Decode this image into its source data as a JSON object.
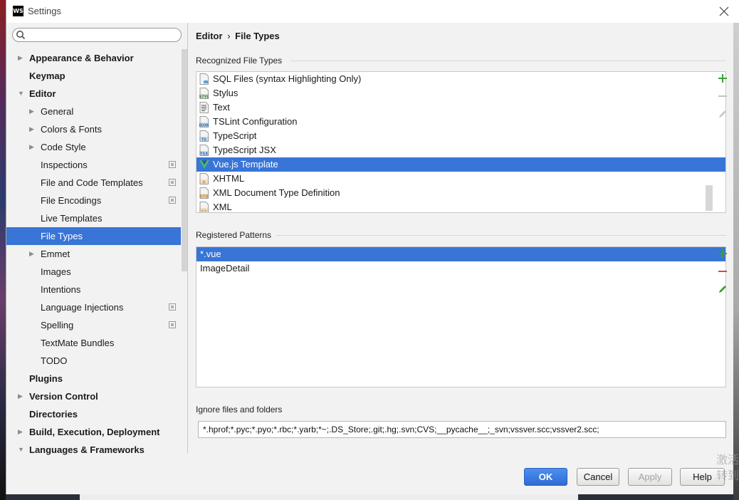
{
  "window": {
    "title": "Settings",
    "logo_text": "WS"
  },
  "search": {
    "value": "",
    "placeholder": ""
  },
  "sidebar": {
    "items": [
      {
        "label": "Appearance & Behavior",
        "level": 0,
        "arrow": "right",
        "bold": true
      },
      {
        "label": "Keymap",
        "level": 0,
        "arrow": "none",
        "bold": true
      },
      {
        "label": "Editor",
        "level": 0,
        "arrow": "down",
        "bold": true
      },
      {
        "label": "General",
        "level": 1,
        "arrow": "right"
      },
      {
        "label": "Colors & Fonts",
        "level": 1,
        "arrow": "right"
      },
      {
        "label": "Code Style",
        "level": 1,
        "arrow": "right"
      },
      {
        "label": "Inspections",
        "level": 1,
        "arrow": "none",
        "project_icon": true
      },
      {
        "label": "File and Code Templates",
        "level": 1,
        "arrow": "none",
        "project_icon": true
      },
      {
        "label": "File Encodings",
        "level": 1,
        "arrow": "none",
        "project_icon": true
      },
      {
        "label": "Live Templates",
        "level": 1,
        "arrow": "none"
      },
      {
        "label": "File Types",
        "level": 1,
        "arrow": "none",
        "selected": true
      },
      {
        "label": "Emmet",
        "level": 1,
        "arrow": "right"
      },
      {
        "label": "Images",
        "level": 1,
        "arrow": "none"
      },
      {
        "label": "Intentions",
        "level": 1,
        "arrow": "none"
      },
      {
        "label": "Language Injections",
        "level": 1,
        "arrow": "none",
        "project_icon": true
      },
      {
        "label": "Spelling",
        "level": 1,
        "arrow": "none",
        "project_icon": true
      },
      {
        "label": "TextMate Bundles",
        "level": 1,
        "arrow": "none"
      },
      {
        "label": "TODO",
        "level": 1,
        "arrow": "none"
      },
      {
        "label": "Plugins",
        "level": 0,
        "arrow": "none",
        "bold": true
      },
      {
        "label": "Version Control",
        "level": 0,
        "arrow": "right",
        "bold": true
      },
      {
        "label": "Directories",
        "level": 0,
        "arrow": "none",
        "bold": true
      },
      {
        "label": "Build, Execution, Deployment",
        "level": 0,
        "arrow": "right",
        "bold": true
      },
      {
        "label": "Languages & Frameworks",
        "level": 0,
        "arrow": "down",
        "bold": true
      }
    ]
  },
  "breadcrumb": {
    "parent": "Editor",
    "separator": "›",
    "current": "File Types"
  },
  "recognized": {
    "title": "Recognized File Types",
    "items": [
      {
        "label": "SQL Files (syntax Highlighting Only)",
        "icon": "sql-file-icon",
        "badge": ""
      },
      {
        "label": "Stylus",
        "icon": "stylus-file-icon",
        "badge": "STYL"
      },
      {
        "label": "Text",
        "icon": "text-file-icon",
        "badge": ""
      },
      {
        "label": "TSLint Configuration",
        "icon": "json-file-icon",
        "badge": "JSON"
      },
      {
        "label": "TypeScript",
        "icon": "typescript-file-icon",
        "badge": "TS"
      },
      {
        "label": "TypeScript JSX",
        "icon": "tsx-file-icon",
        "badge": "TSX"
      },
      {
        "label": "Vue.js Template",
        "icon": "vue-file-icon",
        "badge": "",
        "selected": true
      },
      {
        "label": "XHTML",
        "icon": "xhtml-file-icon",
        "badge": "H"
      },
      {
        "label": "XML Document Type Definition",
        "icon": "dtd-file-icon",
        "badge": "DTD"
      },
      {
        "label": "XML",
        "icon": "xml-file-icon",
        "badge": "<>"
      }
    ]
  },
  "registered": {
    "title": "Registered Patterns",
    "items": [
      {
        "label": "*.vue",
        "selected": true
      },
      {
        "label": "ImageDetail",
        "selected": false
      }
    ]
  },
  "ignore": {
    "title": "Ignore files and folders",
    "value": "*.hprof;*.pyc;*.pyo;*.rbc;*.yarb;*~;.DS_Store;.git;.hg;.svn;CVS;__pycache__;_svn;vssver.scc;vssver2.scc;"
  },
  "buttons": {
    "ok": "OK",
    "cancel": "Cancel",
    "apply": "Apply",
    "help": "Help"
  },
  "colors": {
    "selection": "#3875d7",
    "add_green": "#3a9f3a",
    "remove_red": "#d24545"
  },
  "watermark": {
    "line1": "激活",
    "line2": "转到"
  }
}
